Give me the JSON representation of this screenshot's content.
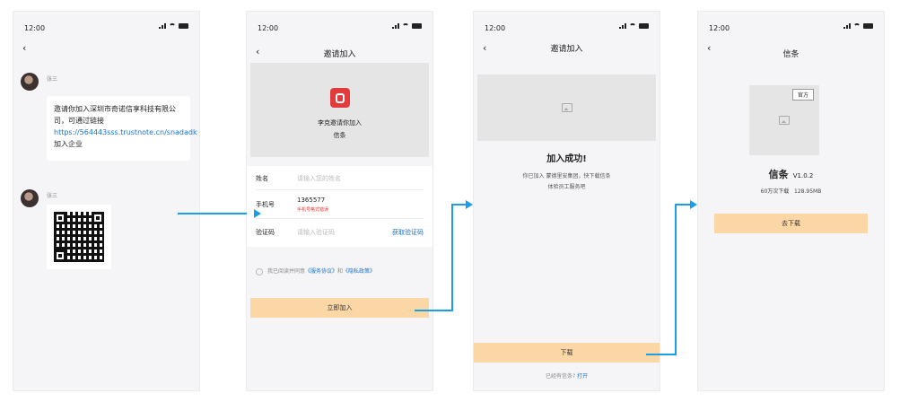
{
  "status_time": "12:00",
  "screen1": {
    "back": "‹",
    "msg1": {
      "sender": "张三",
      "text": "邀请你加入深圳市奇诺信享科技有限公司，可通过链接",
      "link": "https://564443sss.trustnote.cn/snadadk",
      "suffix": " 加入企业"
    },
    "msg2": {
      "sender": "张三"
    }
  },
  "screen2": {
    "back": "‹",
    "title": "邀请加入",
    "inviter_text": "李克邀请你加入",
    "app_name": "信条",
    "form": {
      "name_label": "姓名",
      "name_placeholder": "请输入您的姓名",
      "phone_label": "手机号",
      "phone_value": "1365577",
      "phone_error": "手机号格式错误",
      "code_label": "验证码",
      "code_placeholder": "请输入验证码",
      "get_code": "获取验证码"
    },
    "agree_prefix": "我已阅读并同意",
    "agree_service": "《服务协议》",
    "agree_and": "和",
    "agree_privacy": "《隐私政策》",
    "join_button": "立即加入"
  },
  "screen3": {
    "back": "‹",
    "title": "邀请加入",
    "success_title": "加入成功!",
    "success_line1": "你已加入 蒙德里安集团，快下载信条",
    "success_line2": "体验员工服务吧",
    "download_button": "下载",
    "have_app": "已经有信条?",
    "open_link": "打开"
  },
  "screen4": {
    "back": "‹",
    "title": "信条",
    "official_badge": "官方",
    "app_name": "信条",
    "version": "V1.0.2",
    "downloads": "60万次下载",
    "size": "128.95MB",
    "download_button": "去下载"
  },
  "colors": {
    "accent_blue": "#1a9ee8",
    "cta_bg": "#fad7a5",
    "link": "#1a73c7",
    "error": "#e33333",
    "logo_red": "#e23b3b"
  }
}
